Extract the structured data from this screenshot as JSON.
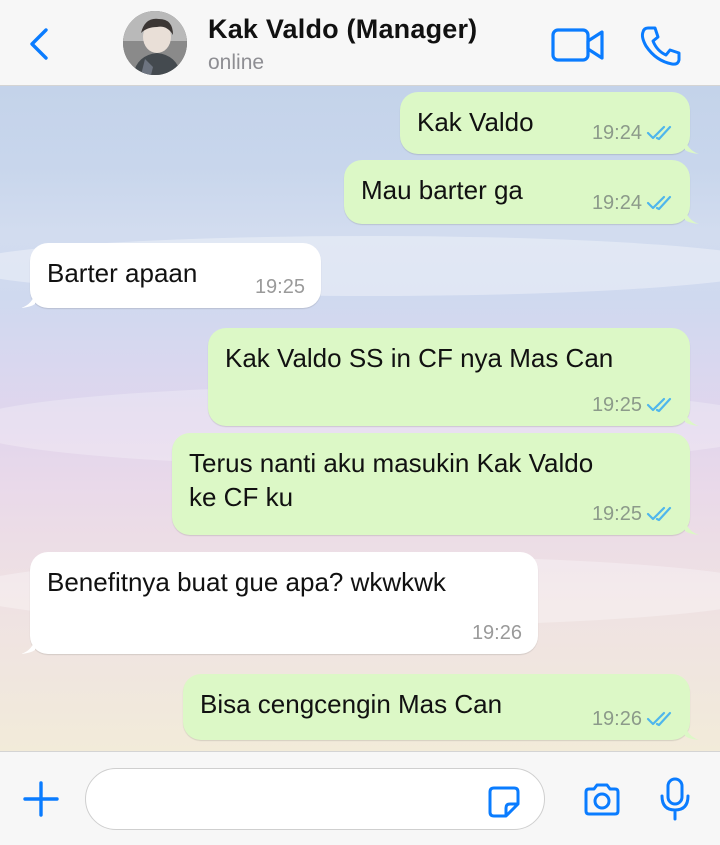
{
  "header": {
    "contact_name": "Kak Valdo (Manager)",
    "status": "online",
    "back_icon": "chevron-left-icon",
    "video_icon": "video-camera-icon",
    "call_icon": "phone-icon"
  },
  "messages": [
    {
      "direction": "outgoing",
      "text": "Kak Valdo",
      "time": "19:24",
      "read": true
    },
    {
      "direction": "outgoing",
      "text": "Mau barter ga",
      "time": "19:24",
      "read": true
    },
    {
      "direction": "incoming",
      "text": "Barter apaan",
      "time": "19:25"
    },
    {
      "direction": "outgoing",
      "text": "Kak Valdo SS in CF nya Mas Can",
      "time": "19:25",
      "read": true
    },
    {
      "direction": "outgoing",
      "text_lines": [
        "Terus nanti aku masukin Kak Valdo",
        "ke CF ku"
      ],
      "time": "19:25",
      "read": true
    },
    {
      "direction": "incoming",
      "text": "Benefitnya buat gue apa? wkwkwk",
      "time": "19:26"
    },
    {
      "direction": "outgoing",
      "text": "Bisa cengcengin Mas Can",
      "time": "19:26",
      "read": true
    }
  ],
  "input": {
    "value": "",
    "plus_icon": "plus-icon",
    "sticker_icon": "sticker-icon",
    "camera_icon": "camera-icon",
    "mic_icon": "microphone-icon"
  },
  "colors": {
    "accent": "#0a7cff",
    "outgoing_bubble": "#dcf8c6",
    "incoming_bubble": "#ffffff",
    "read_ticks": "#4fb6ec"
  }
}
